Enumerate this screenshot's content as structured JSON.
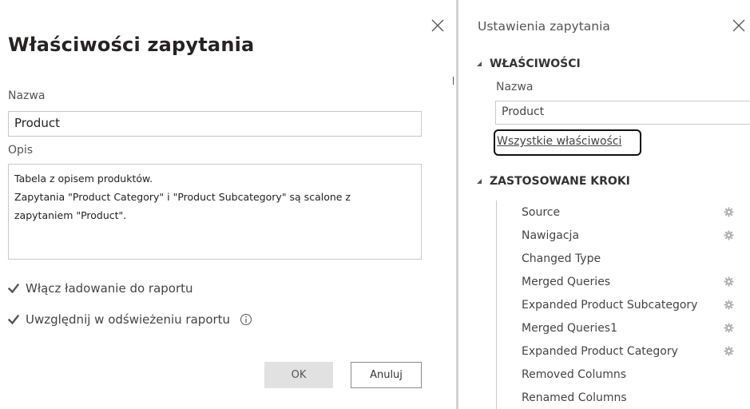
{
  "dialog": {
    "title": "Właściwości zapytania",
    "name_label": "Nazwa",
    "name_value": "Product",
    "description_label": "Opis",
    "description_lines": [
      "Tabela z opisem produktów.",
      "Zapytania \"Product Category\" i \"Product Subcategory\" są scalone z",
      "zapytaniem \"Product\"."
    ],
    "enable_load_label": "Włącz ładowanie do raportu",
    "enable_load_checked": true,
    "include_refresh_label": "Uwzględnij w odświeżeniu raportu",
    "include_refresh_checked": true,
    "ok_label": "OK",
    "cancel_label": "Anuluj"
  },
  "pane": {
    "title": "Ustawienia zapytania",
    "properties_header": "WŁAŚCIWOŚCI",
    "name_label": "Nazwa",
    "name_value": "Product",
    "all_properties_link": "Wszystkie właściwości",
    "applied_steps_header": "ZASTOSOWANE KROKI",
    "steps": [
      {
        "label": "Source",
        "has_settings": true
      },
      {
        "label": "Nawigacja",
        "has_settings": true
      },
      {
        "label": "Changed Type",
        "has_settings": false
      },
      {
        "label": "Merged Queries",
        "has_settings": true
      },
      {
        "label": "Expanded Product Subcategory",
        "has_settings": true
      },
      {
        "label": "Merged Queries1",
        "has_settings": true
      },
      {
        "label": "Expanded Product Category",
        "has_settings": true
      },
      {
        "label": "Removed Columns",
        "has_settings": false
      },
      {
        "label": "Renamed Columns",
        "has_settings": false
      }
    ]
  },
  "icons": {
    "dialog_close": "close-icon",
    "pane_close": "close-icon",
    "checkbox": "checkmark-icon",
    "info": "info-icon",
    "collapse": "collapse-triangle-icon",
    "step_settings": "gear-icon"
  },
  "colors": {
    "checkbox_checked": "#555555",
    "ok_button_bg": "#e1e1e1",
    "divider": "#d3d3d3",
    "gear": "#b0b0b0"
  }
}
